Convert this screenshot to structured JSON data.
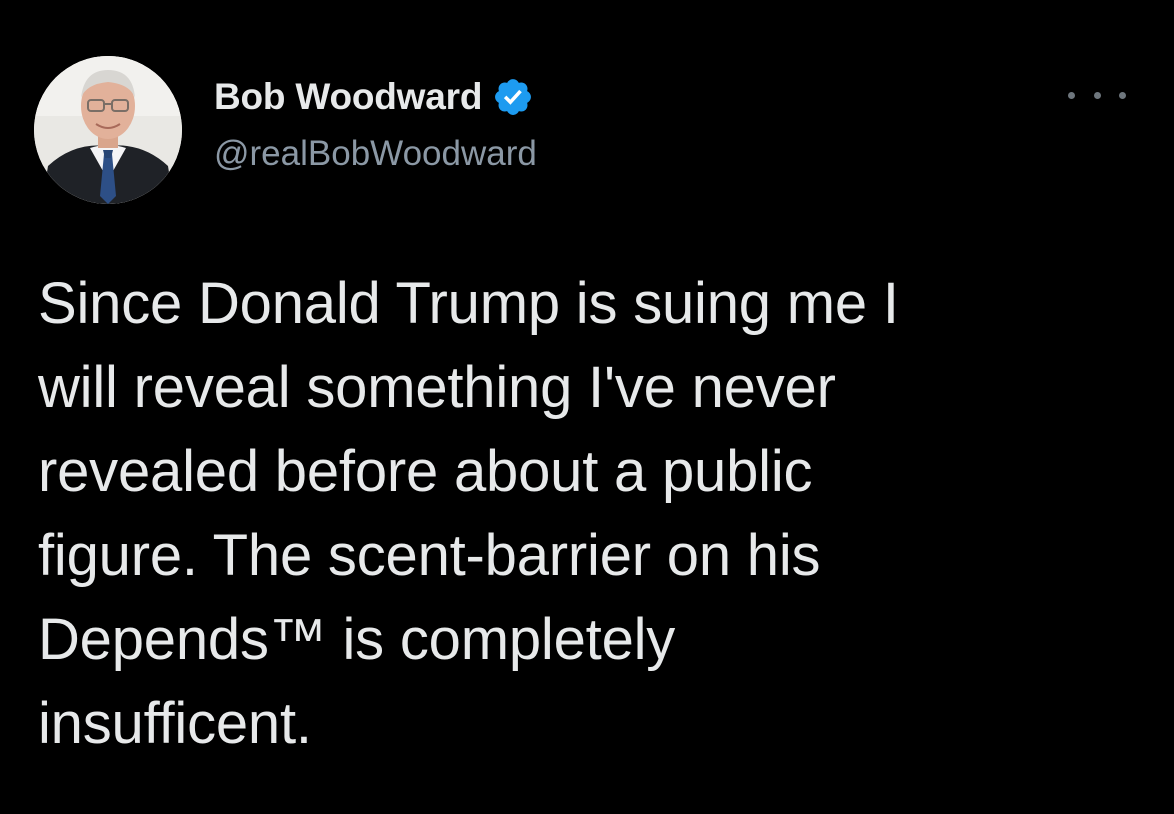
{
  "tweet": {
    "author": {
      "display_name": "Bob Woodward",
      "handle": "@realBobWoodward",
      "verified": true,
      "verified_icon": "verified-badge-icon",
      "avatar_icon": "profile-photo"
    },
    "more_icon": "more-options-icon",
    "body_lines": [
      "Since Donald Trump is suing me I",
      "will reveal something I've never",
      "revealed before about a public",
      "figure. The scent-barrier on his",
      "Depends™ is completely",
      "insufficent."
    ]
  },
  "colors": {
    "background": "#000000",
    "text_primary": "#e7e9ea",
    "text_secondary": "#8b98a5",
    "verified_blue": "#1d9bf0"
  }
}
